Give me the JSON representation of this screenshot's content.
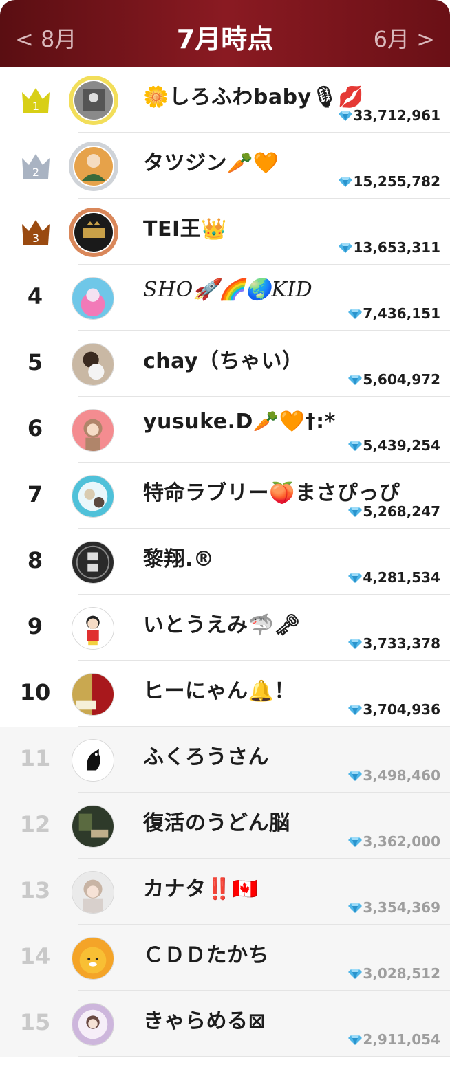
{
  "header": {
    "prev_label": "< 8月",
    "title": "7月時点",
    "next_label": "6月 >"
  },
  "colors": {
    "header_bg": "#7a151c",
    "gold": "#d8cf16",
    "silver": "#a9b3c2",
    "bronze": "#9a4a10",
    "gem": "#4fb6e8"
  },
  "entries": [
    {
      "rank": "1",
      "name": "🌼しろふわbaby🎙💋",
      "score": "33,712,961",
      "crown": "gold"
    },
    {
      "rank": "2",
      "name": "タツジン🥕🧡",
      "score": "15,255,782",
      "crown": "silver"
    },
    {
      "rank": "3",
      "name": "TEI王👑",
      "score": "13,653,311",
      "crown": "bronze"
    },
    {
      "rank": "4",
      "name": "SHO🚀🌈🌏KID",
      "score": "7,436,151"
    },
    {
      "rank": "5",
      "name": "chay（ちゃい）",
      "score": "5,604,972"
    },
    {
      "rank": "6",
      "name": "yusuke.D🥕🧡†:*",
      "score": "5,439,254"
    },
    {
      "rank": "7",
      "name": "特命ラブリー🍑まさぴっぴ",
      "score": "5,268,247"
    },
    {
      "rank": "8",
      "name": "黎翔.®",
      "score": "4,281,534"
    },
    {
      "rank": "9",
      "name": "いとうえみ🦈🗝",
      "score": "3,733,378"
    },
    {
      "rank": "10",
      "name": "ヒーにゃん🔔！",
      "score": "3,704,936"
    },
    {
      "rank": "11",
      "name": "ふくろうさん",
      "score": "3,498,460"
    },
    {
      "rank": "12",
      "name": "復活のうどん脳",
      "score": "3,362,000"
    },
    {
      "rank": "13",
      "name": "カナタ‼️🇨🇦",
      "score": "3,354,369"
    },
    {
      "rank": "14",
      "name": "ＣＤＤたかち",
      "score": "3,028,512"
    },
    {
      "rank": "15",
      "name": "きゃらめる⊠",
      "score": "2,911,054"
    }
  ]
}
